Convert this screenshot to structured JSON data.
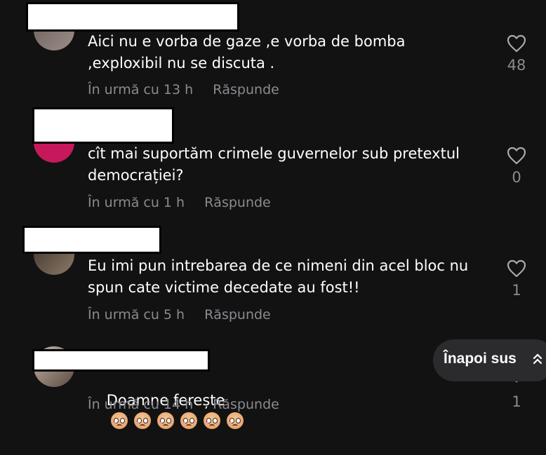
{
  "comments": [
    {
      "text": "Aici nu e vorba de gaze ,e vorba de bomba\n,exploxibil nu se discuta .",
      "time": "În urmă cu 13 h",
      "reply": "Răspunde",
      "likes": "48"
    },
    {
      "text": "cît mai suportăm crimele guvernelor sub pretextul\ndemocrației?",
      "time": "În urmă cu 1 h",
      "reply": "Răspunde",
      "likes": "0"
    },
    {
      "text": "Eu imi pun intrebarea de ce nimeni din acel bloc nu\nspun cate victime decedate au fost!!",
      "time": "În urmă cu 5 h",
      "reply": "Răspunde",
      "likes": "1"
    },
    {
      "text": "Doamne ferește",
      "time": "În urmă cu 14 h",
      "reply": "Răspunde",
      "likes": "1",
      "emoji_count": 6,
      "emoji": "pleading-face-icon"
    }
  ],
  "back_to_top": "Înapoi sus",
  "colors": {
    "background": "#121212",
    "muted": "#8a8b91",
    "pill": "#2b2b2d"
  }
}
